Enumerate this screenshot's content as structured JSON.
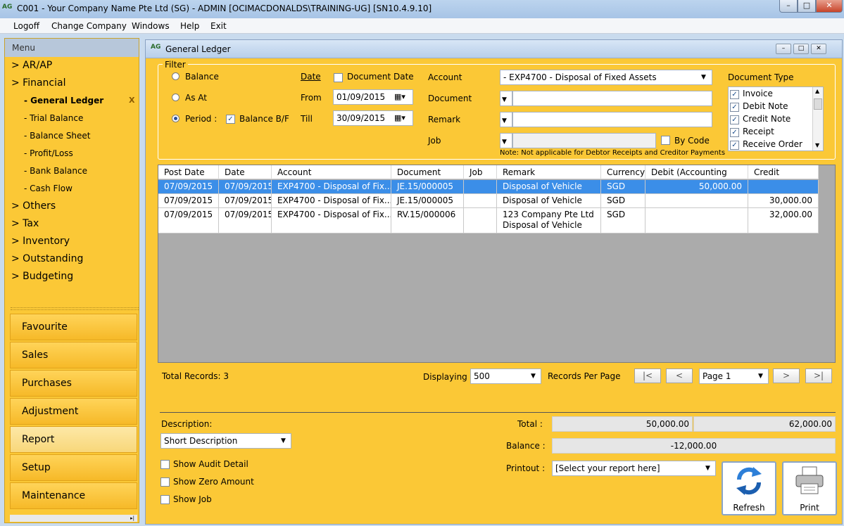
{
  "window": {
    "title": "C001 - Your Company Name Pte Ltd (SG) - ADMIN [OCIMACDONALDS\\TRAINING-UG] [SN10.4.9.10]",
    "icon": "AG",
    "min_icon": "minimize-icon",
    "max_icon": "maximize-icon",
    "close_icon": "close-icon",
    "min": "–",
    "max": "□",
    "close": "✕"
  },
  "menubar": [
    "Logoff",
    "Change Company",
    "Windows",
    "Help",
    "Exit"
  ],
  "sidebar": {
    "header": "Menu",
    "tree": [
      {
        "label": "> AR/AP",
        "level": 0
      },
      {
        "label": "> Financial",
        "level": 0
      },
      {
        "label": "- General Ledger",
        "level": 1,
        "selected": true
      },
      {
        "label": "- Trial Balance",
        "level": 1
      },
      {
        "label": "- Balance Sheet",
        "level": 1
      },
      {
        "label": "- Profit/Loss",
        "level": 1
      },
      {
        "label": "- Bank Balance",
        "level": 1
      },
      {
        "label": "- Cash Flow",
        "level": 1
      },
      {
        "label": "> Others",
        "level": 0
      },
      {
        "label": "> Tax",
        "level": 0
      },
      {
        "label": "> Inventory",
        "level": 0
      },
      {
        "label": "> Outstanding",
        "level": 0
      },
      {
        "label": "> Budgeting",
        "level": 0
      }
    ],
    "close_mark": "X",
    "nav": [
      "Favourite",
      "Sales",
      "Purchases",
      "Adjustment",
      "Report",
      "Setup",
      "Maintenance"
    ],
    "active_nav": "Report",
    "foot": "▸|"
  },
  "gl": {
    "title": "General Ledger",
    "icon": "AG",
    "filter": {
      "label": "Filter",
      "balance": "Balance",
      "as_at": "As At",
      "period": "Period :",
      "balance_bf": "Balance B/F",
      "selected_mode": "Period",
      "date_link": "Date",
      "document_date": "Document Date",
      "from_label": "From",
      "from": "01/09/2015",
      "till_label": "Till",
      "till": "30/09/2015",
      "account_label": "Account",
      "account": "- EXP4700 - Disposal of Fixed Assets",
      "document_label": "Document",
      "document": "",
      "remark_label": "Remark",
      "remark": "",
      "job_label": "Job",
      "job": "",
      "by_code": "By Code",
      "note": "Note: Not applicable for Debtor Receipts and Creditor Payments",
      "doc_type_label": "Document Type",
      "doc_types": [
        "Invoice",
        "Debit Note",
        "Credit Note",
        "Receipt",
        "Receive Order"
      ]
    },
    "grid": {
      "columns": [
        "Post Date",
        "Date",
        "Account",
        "Document",
        "Job",
        "Remark",
        "Currency",
        "Debit (Accounting",
        "Credit"
      ],
      "rows": [
        {
          "post_date": "07/09/2015",
          "date": "07/09/2015",
          "account": "EXP4700 - Disposal of Fix...",
          "document": "JE.15/000005",
          "job": "",
          "remark": "Disposal of Vehicle",
          "remark2": "",
          "currency": "SGD",
          "debit": "50,000.00",
          "credit": ""
        },
        {
          "post_date": "07/09/2015",
          "date": "07/09/2015",
          "account": "EXP4700 - Disposal of Fix...",
          "document": "JE.15/000005",
          "job": "",
          "remark": "Disposal of Vehicle",
          "remark2": "",
          "currency": "SGD",
          "debit": "",
          "credit": "30,000.00"
        },
        {
          "post_date": "07/09/2015",
          "date": "07/09/2015",
          "account": "EXP4700 - Disposal of Fix...",
          "document": "RV.15/000006",
          "job": "",
          "remark": "123 Company Pte Ltd",
          "remark2": "Disposal of Vehicle",
          "currency": "SGD",
          "debit": "",
          "credit": "32,000.00"
        }
      ]
    },
    "pager": {
      "total": "Total Records: 3",
      "displaying": "Displaying",
      "per_page_value": "500",
      "per_page_label": "Records Per Page",
      "first": "|<",
      "prev": "<",
      "page": "Page 1",
      "next": ">",
      "last": ">|"
    },
    "bottom": {
      "description_label": "Description:",
      "description": "Short Description",
      "show_audit": "Show Audit Detail",
      "show_zero": "Show Zero Amount",
      "show_job": "Show Job",
      "total_label": "Total :",
      "total_debit": "50,000.00",
      "total_credit": "62,000.00",
      "balance_label": "Balance :",
      "balance": "-12,000.00",
      "printout_label": "Printout :",
      "printout": "[Select your report here]",
      "refresh": "Refresh",
      "print": "Print"
    }
  },
  "colors": {
    "accent": "#fbc836",
    "selection": "#3b8ee8",
    "titlebar": "#bcd4ee"
  }
}
